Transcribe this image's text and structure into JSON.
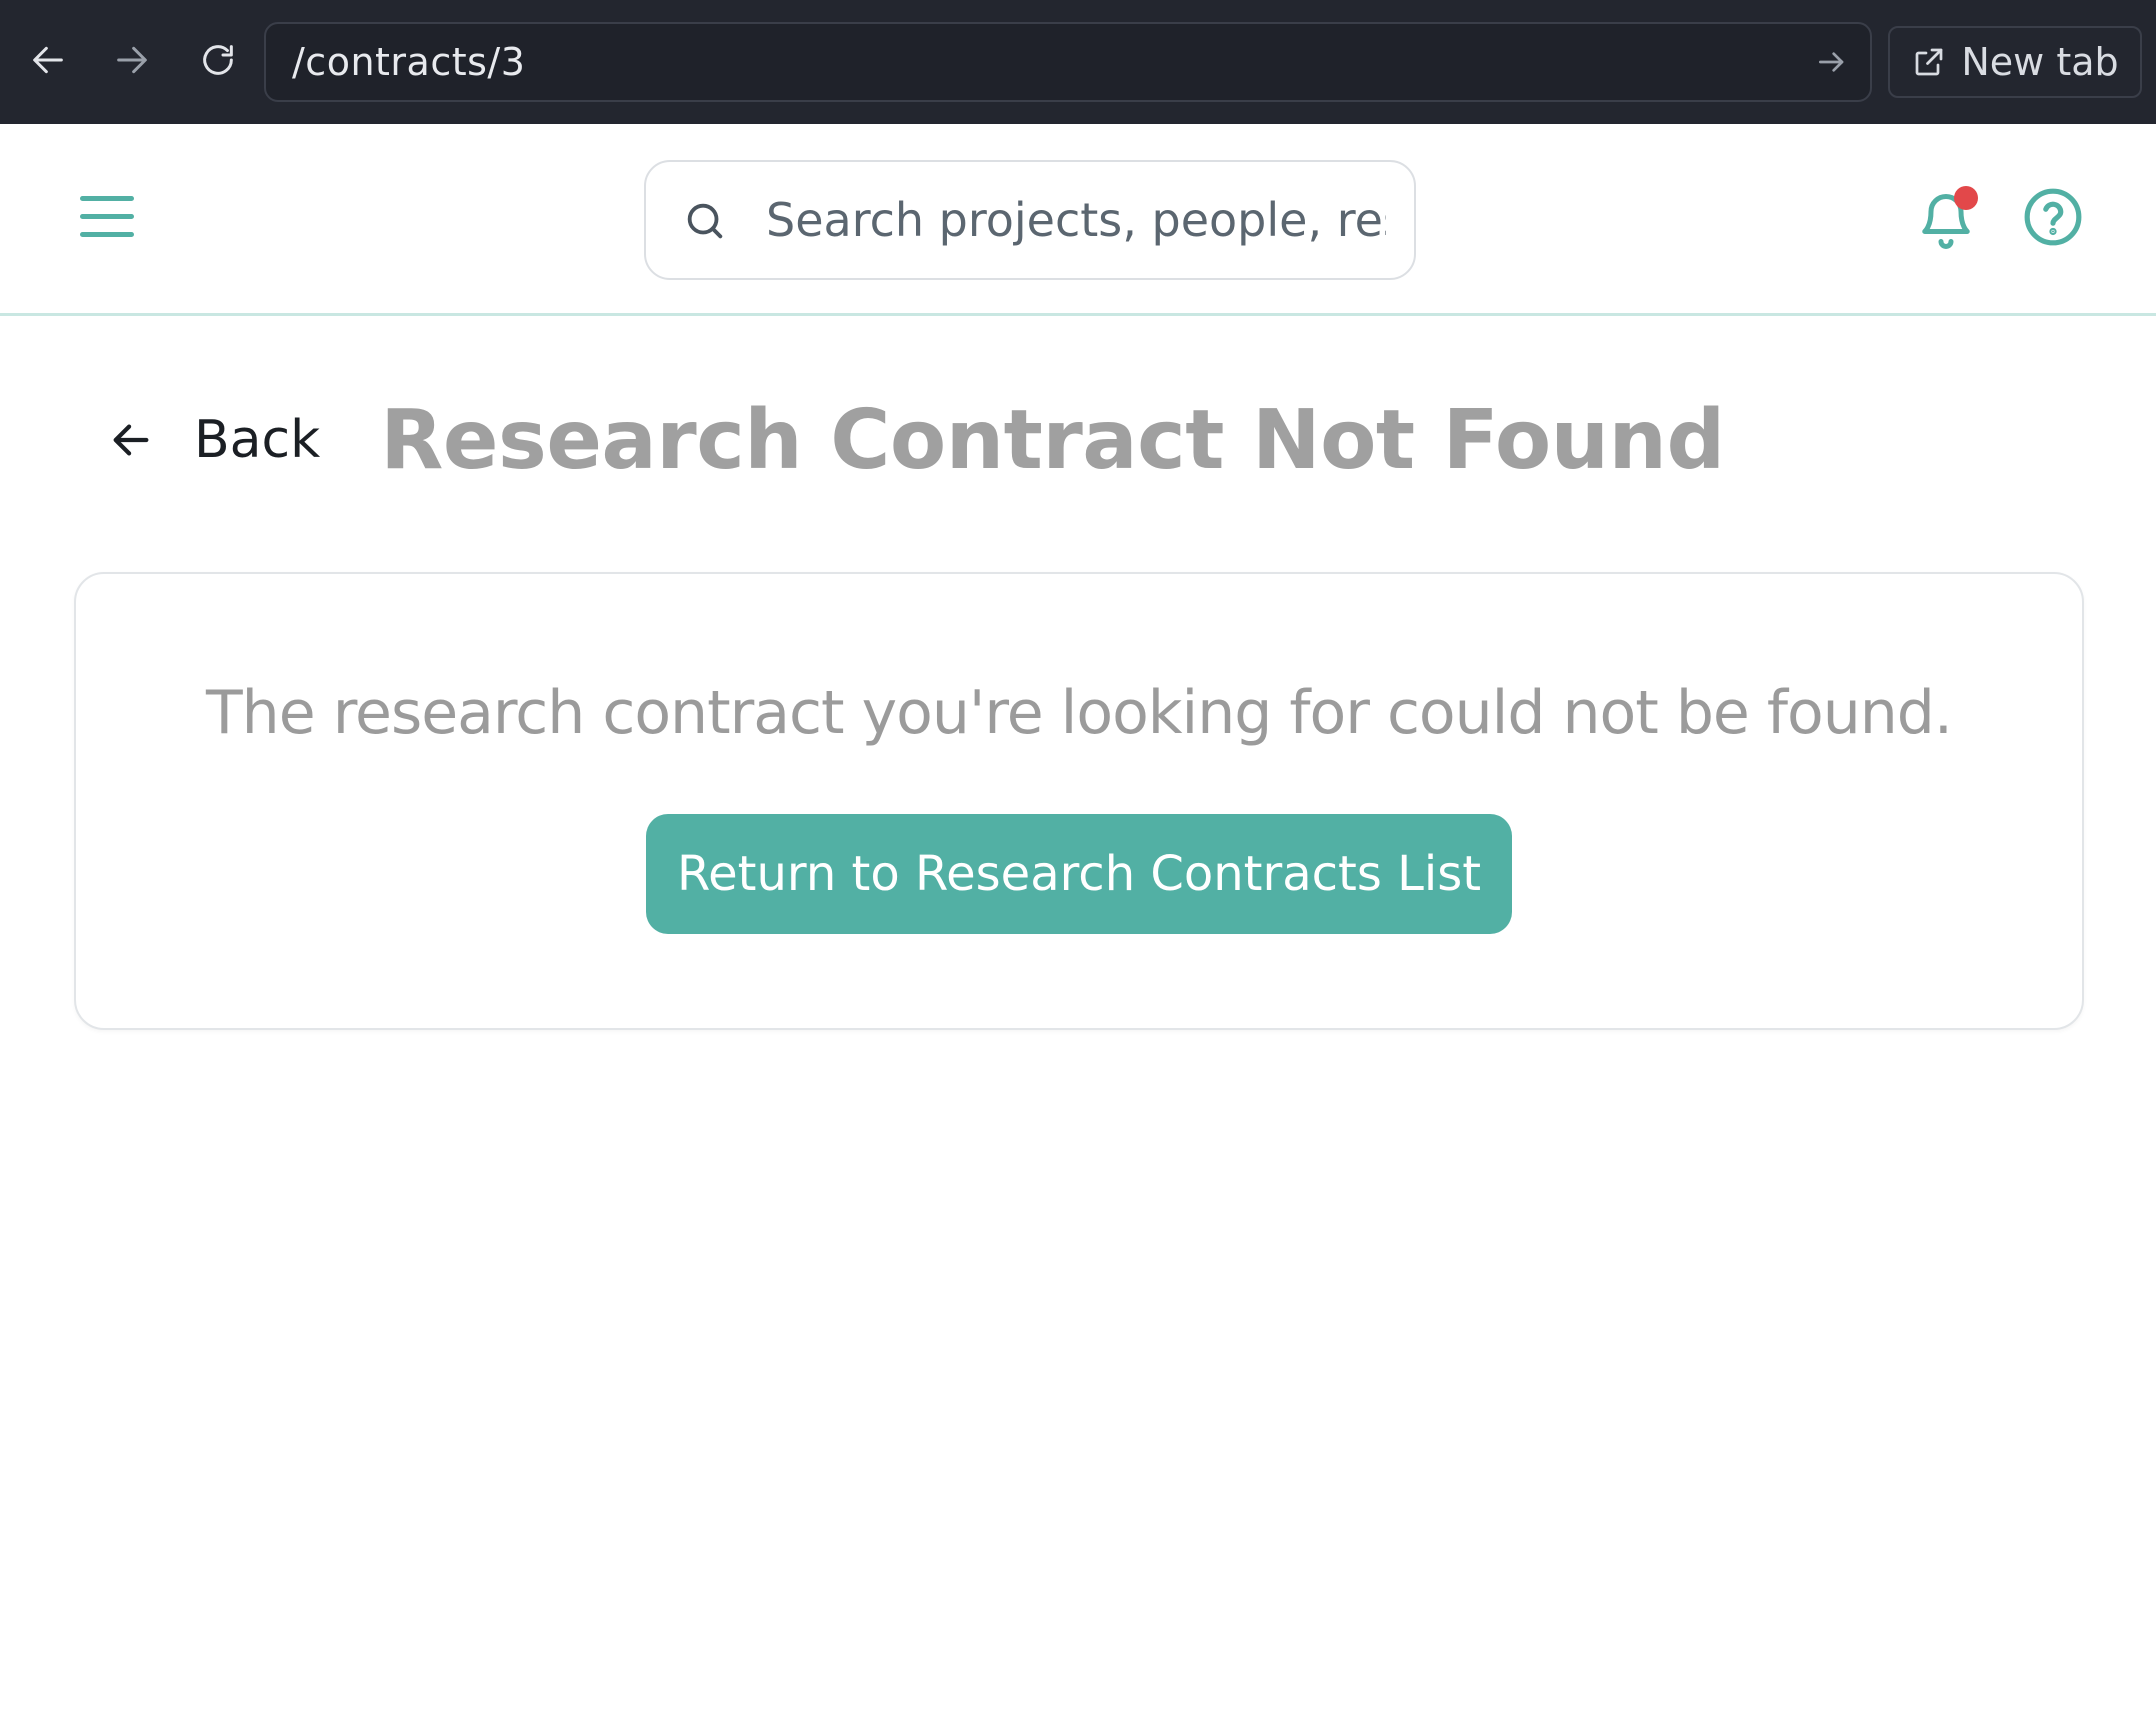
{
  "browser": {
    "url": "/contracts/3",
    "new_tab_label": "New tab",
    "icons": {
      "back": "arrow-left-icon",
      "forward": "arrow-right-icon",
      "reload": "reload-icon",
      "go": "arrow-right-icon",
      "new_tab": "external-link-icon"
    }
  },
  "header": {
    "search": {
      "placeholder": "Search projects, people, resources..."
    },
    "icons": {
      "menu": "hamburger-menu-icon",
      "search": "search-icon",
      "notifications": "bell-icon",
      "help": "help-circle-icon"
    },
    "notification_badge_color": "#e2484a"
  },
  "page": {
    "back_label": "Back",
    "title": "Research Contract Not Found",
    "message": "The research contract you're looking for could not be found.",
    "return_button_label": "Return to Research Contracts List"
  },
  "colors": {
    "accent": "#52b0a4",
    "title_gray": "#a0a0a0",
    "chrome_bg": "#23262f"
  }
}
